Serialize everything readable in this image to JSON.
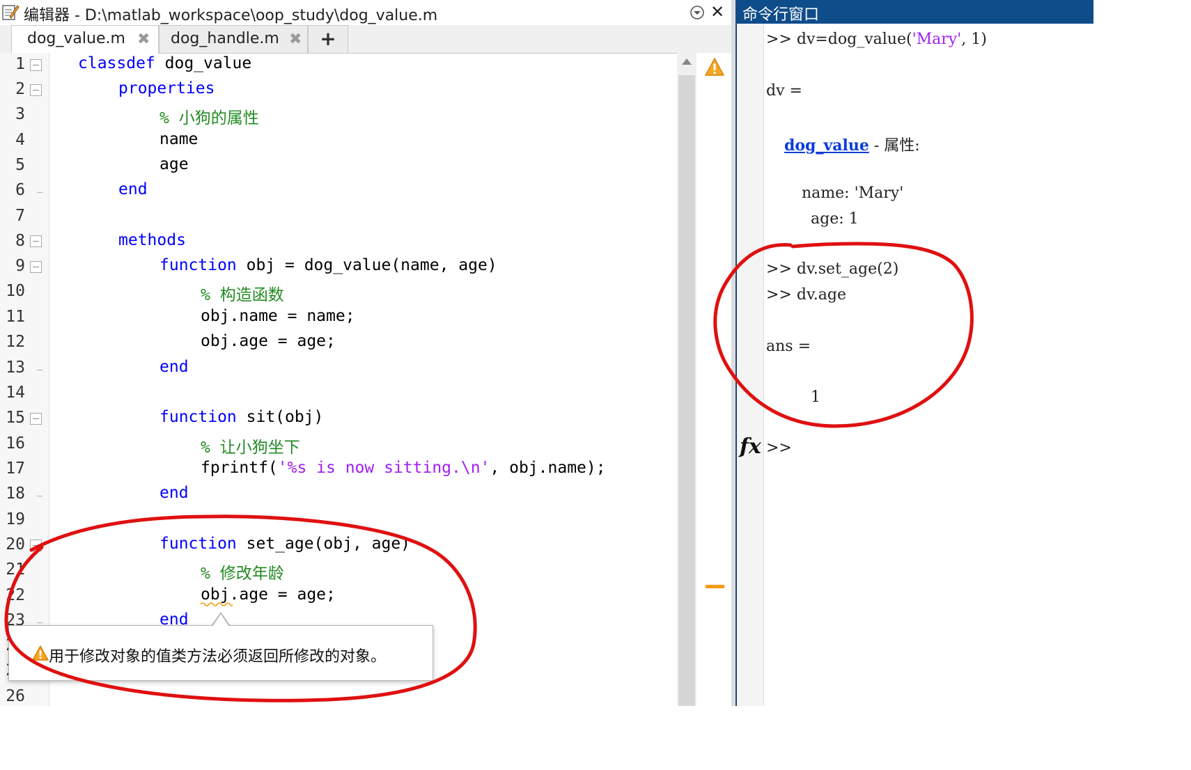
{
  "editor": {
    "title": "编辑器 - D:\\matlab_workspace\\oop_study\\dog_value.m",
    "tabs": [
      {
        "label": "dog_value.m",
        "active": true
      },
      {
        "label": "dog_handle.m",
        "active": false
      }
    ],
    "add_tab": "+",
    "line_numbers": [
      "1",
      "2",
      "3",
      "4",
      "5",
      "6",
      "7",
      "8",
      "9",
      "10",
      "11",
      "12",
      "13",
      "14",
      "15",
      "16",
      "17",
      "18",
      "19",
      "20",
      "21",
      "22",
      "23",
      "24",
      "25",
      "26"
    ],
    "code": {
      "l1_kw": "classdef",
      "l1_rest": " dog_value",
      "l2_kw": "properties",
      "l3_cm": "% 小狗的属性",
      "l4": "name",
      "l5": "age",
      "l6_kw": "end",
      "l8_kw": "methods",
      "l9_kw": "function",
      "l9_rest": " obj = dog_value(name, age)",
      "l10_cm": "% 构造函数",
      "l11": "obj.name = name;",
      "l12": "obj.age = age;",
      "l13_kw": "end",
      "l15_kw": "function",
      "l15_rest": " sit(obj)",
      "l16_cm": "% 让小狗坐下",
      "l17_a": "fprintf(",
      "l17_str": "'%s is now sitting.\\n'",
      "l17_b": ", obj.name);",
      "l18_kw": "end",
      "l20_kw": "function",
      "l20_rest": " set_age(obj, age)",
      "l21_cm": "% 修改年龄",
      "l22": "obj.age = age;",
      "l23_kw": "end"
    },
    "tooltip": "用于修改对象的值类方法必须返回所修改的对象。",
    "warning_color": "#f39c12"
  },
  "command_window": {
    "title": "命令行窗口",
    "lines": {
      "cmd1_a": ">> dv=dog_value(",
      "cmd1_str": "'Mary'",
      "cmd1_b": ", 1)",
      "dv_eq": "dv =",
      "class_link": "dog_value",
      "class_suffix": " - 属性:",
      "prop_name": "name: 'Mary'",
      "prop_age": "age: 1",
      "cmd2": ">> dv.set_age(2)",
      "cmd3": ">> dv.age",
      "ans_eq": "ans =",
      "ans_val": "1",
      "prompt": ">>"
    },
    "fx_label": "fx"
  },
  "annotation_color": "#e01010"
}
